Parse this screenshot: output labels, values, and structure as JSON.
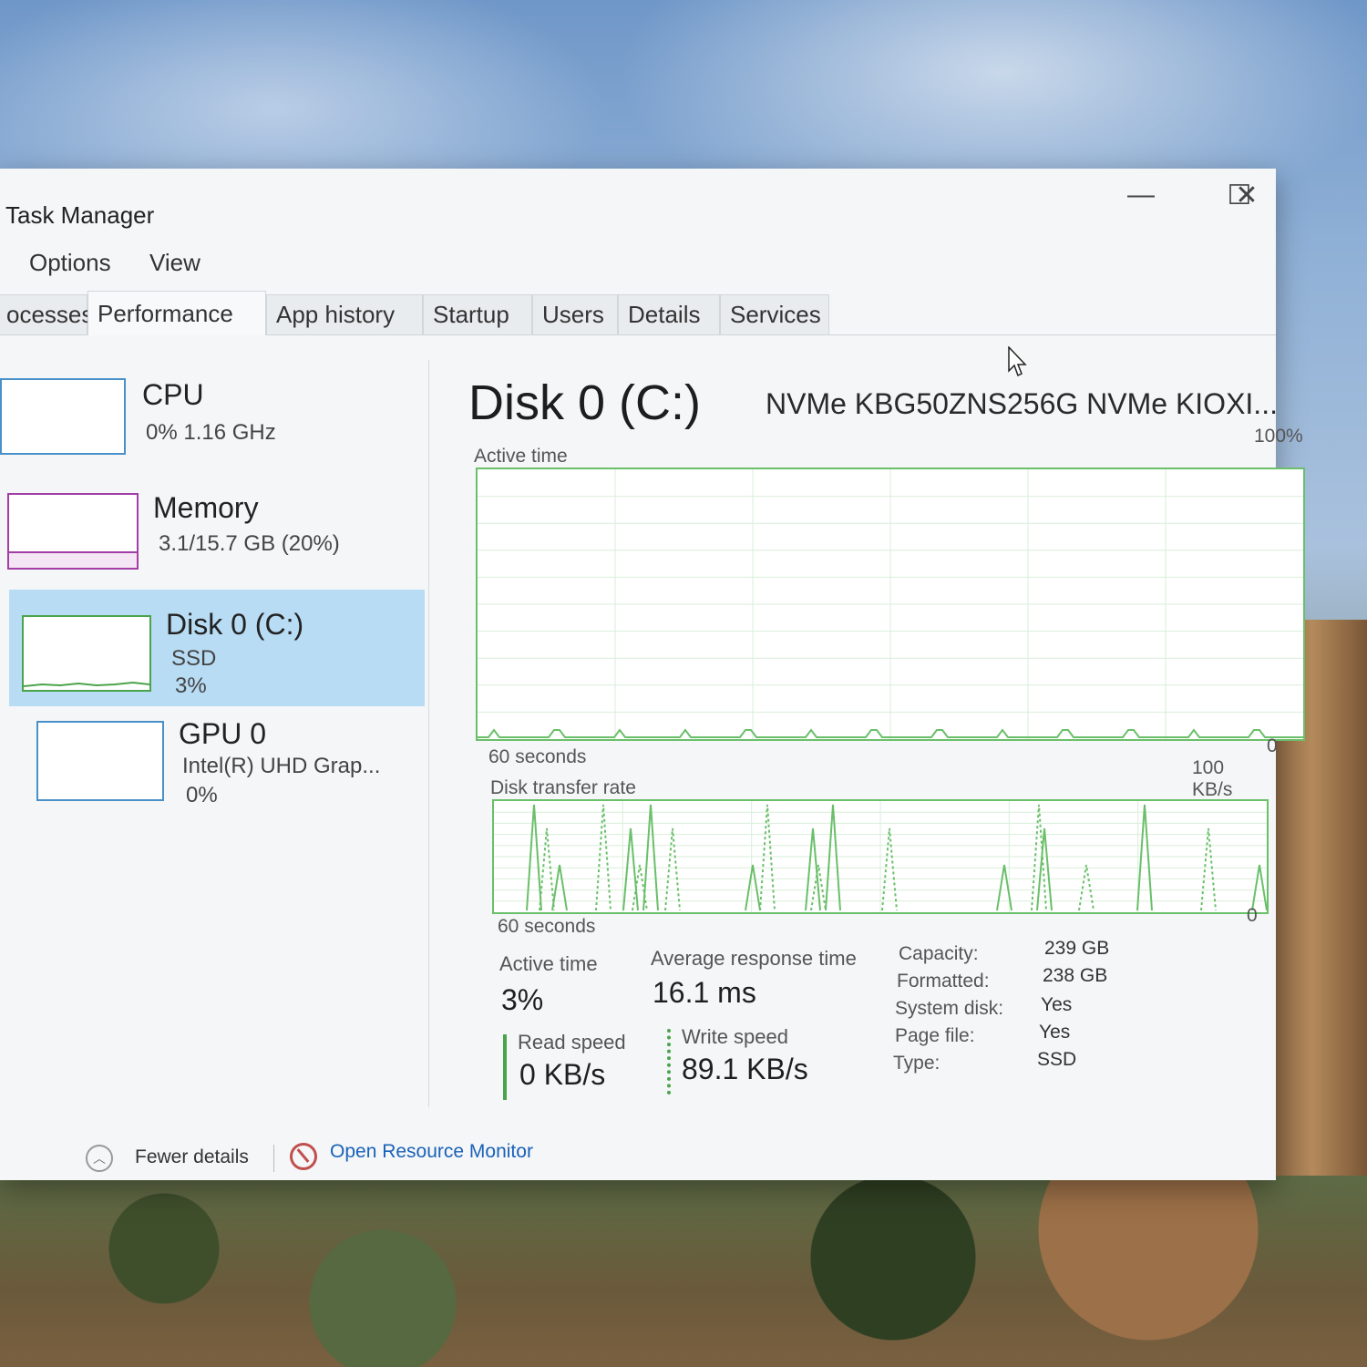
{
  "window": {
    "title": "Task Manager",
    "controls": {
      "minimize": "—",
      "maximize": "☐",
      "close": "✕"
    }
  },
  "menu": [
    "Options",
    "View"
  ],
  "tabs": [
    "ocesses",
    "Performance",
    "App history",
    "Startup",
    "Users",
    "Details",
    "Services"
  ],
  "sidebar": {
    "items": [
      {
        "name": "CPU",
        "sub1": "0% 1.16 GHz",
        "sub2": "",
        "color": "#4a90c8"
      },
      {
        "name": "Memory",
        "sub1": "3.1/15.7 GB (20%)",
        "sub2": "",
        "color": "#a23ea5"
      },
      {
        "name": "Disk 0 (C:)",
        "sub1": "SSD",
        "sub2": "3%",
        "color": "#4aa44a"
      },
      {
        "name": "GPU 0",
        "sub1": "Intel(R) UHD Grap...",
        "sub2": "0%",
        "color": "#4a90c8"
      }
    ]
  },
  "main": {
    "title": "Disk 0 (C:)",
    "model": "NVMe KBG50ZNS256G NVMe KIOXI...",
    "active_graph": {
      "label": "Active time",
      "max_label": "100%",
      "min_label": "0",
      "time_label": "60 seconds"
    },
    "transfer_graph": {
      "label": "Disk transfer rate",
      "max_label": "100 KB/s",
      "min_label": "0",
      "time_label": "60 seconds"
    },
    "stats": {
      "active_time_label": "Active time",
      "active_time_value": "3%",
      "avg_response_label": "Average response time",
      "avg_response_value": "16.1 ms",
      "read_label": "Read speed",
      "read_value": "0 KB/s",
      "write_label": "Write speed",
      "write_value": "89.1 KB/s"
    },
    "properties": [
      {
        "key": "Capacity:",
        "value": "239 GB"
      },
      {
        "key": "Formatted:",
        "value": "238 GB"
      },
      {
        "key": "System disk:",
        "value": "Yes"
      },
      {
        "key": "Page file:",
        "value": "Yes"
      },
      {
        "key": "Type:",
        "value": "SSD"
      }
    ]
  },
  "footer": {
    "fewer_details": "Fewer details",
    "open_resource_monitor": "Open Resource Monitor",
    "link_color": "#1a62b8"
  },
  "colors": {
    "graph_green": "#6abf6a",
    "selected_bg": "#b8dcf4"
  }
}
